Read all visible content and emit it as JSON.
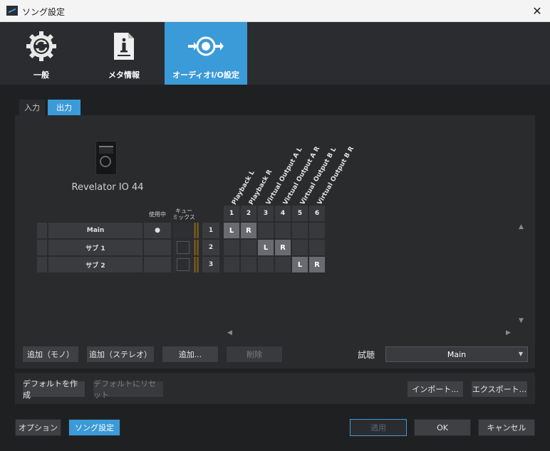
{
  "window": {
    "title": "ソング設定",
    "close": "✕"
  },
  "categories": [
    {
      "label": "一般",
      "icon": "gear-refresh-icon",
      "active": false
    },
    {
      "label": "メタ情報",
      "icon": "info-document-icon",
      "active": false
    },
    {
      "label": "オーディオI/O設定",
      "icon": "audio-io-icon",
      "active": true
    }
  ],
  "subtabs": {
    "input": "入力",
    "output": "出力"
  },
  "device": {
    "name": "Revelator IO 44"
  },
  "headers": {
    "in_use": "使用中",
    "cue_mix_1": "キュー",
    "cue_mix_2": "ミックス"
  },
  "columns": [
    {
      "num": "1",
      "name": "Playback L"
    },
    {
      "num": "2",
      "name": "Playback R"
    },
    {
      "num": "3",
      "name": "Virtual Output A L"
    },
    {
      "num": "4",
      "name": "Virtual Output A R"
    },
    {
      "num": "5",
      "name": "Virtual Output B L"
    },
    {
      "num": "6",
      "name": "Virtual Output B R"
    }
  ],
  "rows": [
    {
      "name": "Main",
      "num": "1",
      "in_use": "●",
      "assign": [
        "L",
        "R",
        "",
        "",
        "",
        ""
      ]
    },
    {
      "name": "サブ 1",
      "num": "2",
      "in_use": "",
      "assign": [
        "",
        "",
        "L",
        "R",
        "",
        ""
      ]
    },
    {
      "name": "サブ 2",
      "num": "3",
      "in_use": "",
      "assign": [
        "",
        "",
        "",
        "",
        "L",
        "R"
      ]
    }
  ],
  "buttons": {
    "add_mono": "追加（モノ）",
    "add_stereo": "追加（ステレオ）",
    "add": "追加...",
    "delete": "削除",
    "audition_label": "試聴",
    "audition_value": "Main",
    "make_default": "デフォルトを作成",
    "reset_default": "デフォルトにリセット",
    "import": "インポート...",
    "export": "エクスポート...",
    "options": "オプション",
    "song_settings": "ソング設定",
    "apply": "適用",
    "ok": "OK",
    "cancel": "キャンセル"
  },
  "glyphs": {
    "up": "▲",
    "down": "▼",
    "left": "◀",
    "right": "▶",
    "dropdown": "▼"
  },
  "colors": {
    "accent": "#3b9ad8",
    "background": "#1f2022",
    "panel": "#2a2b2d"
  }
}
